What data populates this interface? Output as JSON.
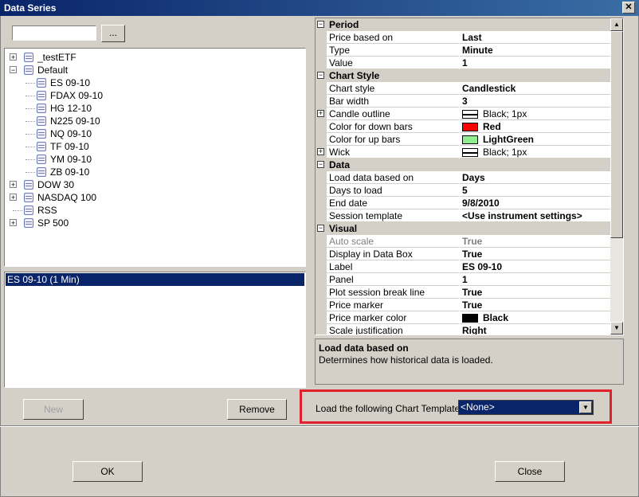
{
  "window": {
    "title": "Data Series",
    "close_glyph": "✕"
  },
  "search": {
    "value": "",
    "browse_label": "..."
  },
  "tree": [
    {
      "label": "_testETF",
      "expander": "+",
      "level": 0
    },
    {
      "label": "Default",
      "expander": "−",
      "level": 0
    },
    {
      "label": "ES 09-10",
      "level": 1
    },
    {
      "label": "FDAX 09-10",
      "level": 1
    },
    {
      "label": "HG 12-10",
      "level": 1
    },
    {
      "label": "N225 09-10",
      "level": 1
    },
    {
      "label": "NQ 09-10",
      "level": 1
    },
    {
      "label": "TF 09-10",
      "level": 1
    },
    {
      "label": "YM 09-10",
      "level": 1
    },
    {
      "label": "ZB 09-10",
      "level": 1
    },
    {
      "label": "DOW 30",
      "expander": "+",
      "level": 0
    },
    {
      "label": "NASDAQ 100",
      "expander": "+",
      "level": 0
    },
    {
      "label": "RSS",
      "level": 0
    },
    {
      "label": "SP 500",
      "expander": "+",
      "level": 0
    }
  ],
  "series_list": {
    "selected": "ES 09-10 (1 Min)"
  },
  "buttons": {
    "new": "New",
    "remove": "Remove",
    "ok": "OK",
    "close": "Close"
  },
  "properties": {
    "period": {
      "title": "Period",
      "rows": [
        {
          "name": "Price based on",
          "value": "Last"
        },
        {
          "name": "Type",
          "value": "Minute"
        },
        {
          "name": "Value",
          "value": "1"
        }
      ]
    },
    "chart_style": {
      "title": "Chart Style",
      "rows": [
        {
          "name": "Chart style",
          "value": "Candlestick"
        },
        {
          "name": "Bar width",
          "value": "3"
        },
        {
          "name": "Candle outline",
          "value": "Black; 1px"
        },
        {
          "name": "Color for down bars",
          "value": "Red"
        },
        {
          "name": "Color for up bars",
          "value": "LightGreen"
        },
        {
          "name": "Wick",
          "value": "Black; 1px"
        }
      ]
    },
    "data": {
      "title": "Data",
      "rows": [
        {
          "name": "Load data based on",
          "value": "Days"
        },
        {
          "name": "Days to load",
          "value": "5"
        },
        {
          "name": "End date",
          "value": "9/8/2010"
        },
        {
          "name": "Session template",
          "value": "<Use instrument settings>"
        }
      ]
    },
    "visual": {
      "title": "Visual",
      "rows": [
        {
          "name": "Auto scale",
          "value": "True"
        },
        {
          "name": "Display in Data Box",
          "value": "True"
        },
        {
          "name": "Label",
          "value": "ES 09-10"
        },
        {
          "name": "Panel",
          "value": "1"
        },
        {
          "name": "Plot session break line",
          "value": "True"
        },
        {
          "name": "Price marker",
          "value": "True"
        },
        {
          "name": "Price marker color",
          "value": "Black"
        },
        {
          "name": "Scale justification",
          "value": "Right"
        }
      ]
    }
  },
  "colors": {
    "red": "#ff0000",
    "lightgreen": "#90ee90",
    "black": "#000000",
    "selection": "#0a246a",
    "highlight_border": "#e0202a"
  },
  "description": {
    "title": "Load data based on",
    "text": "Determines how historical data is loaded."
  },
  "template": {
    "label": "Load the following Chart Template:",
    "selected": "<None>"
  },
  "icons": {
    "collapse": "minus-box-icon",
    "expand": "plus-box-icon",
    "database": "database-icon",
    "dropdown": "dropdown-arrow-icon"
  }
}
